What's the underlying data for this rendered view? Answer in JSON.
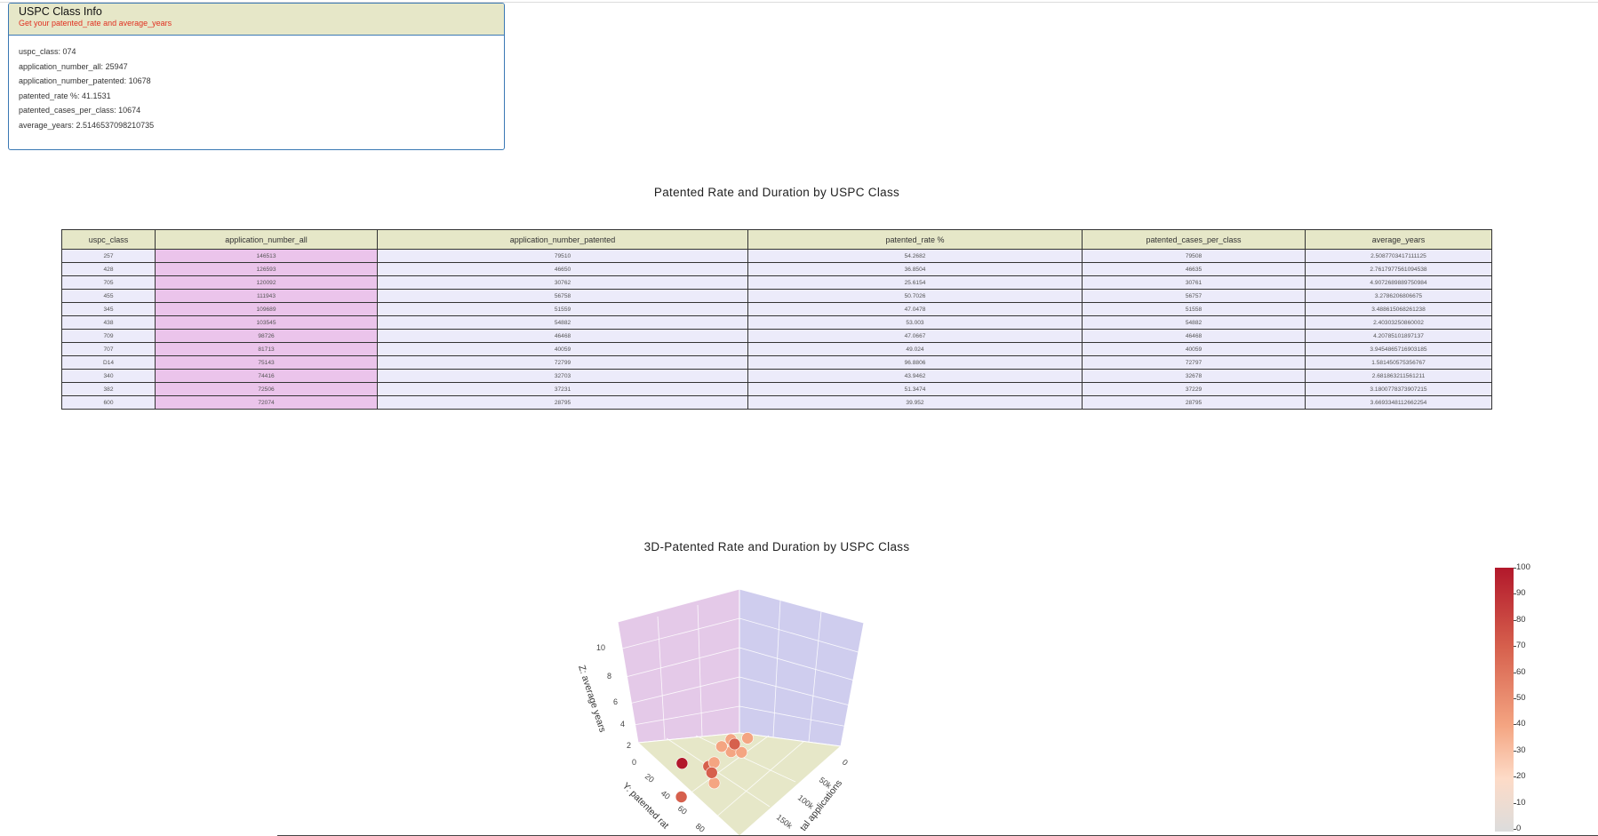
{
  "info_card": {
    "title": "USPC Class Info",
    "subtitle": "Get your patented_rate and average_years",
    "lines": [
      "uspc_class: 074",
      "application_number_all: 25947",
      "application_number_patented: 10678",
      "patented_rate %: 41.1531",
      "patented_cases_per_class: 10674",
      "average_years: 2.5146537098210735"
    ]
  },
  "table_section": {
    "title": "Patented Rate and Duration by USPC Class",
    "columns": [
      "uspc_class",
      "application_number_all",
      "application_number_patented",
      "patented_rate %",
      "patented_cases_per_class",
      "average_years"
    ],
    "rows": [
      [
        "257",
        "146513",
        "79510",
        "54.2682",
        "79508",
        "2.5087703417111125"
      ],
      [
        "428",
        "126593",
        "46650",
        "36.8504",
        "46635",
        "2.7617977561094538"
      ],
      [
        "705",
        "120092",
        "30762",
        "25.6154",
        "30761",
        "4.9072689889750984"
      ],
      [
        "455",
        "111943",
        "56758",
        "50.7026",
        "56757",
        "3.2786206806675"
      ],
      [
        "345",
        "109689",
        "51559",
        "47.0478",
        "51558",
        "3.488615068261238"
      ],
      [
        "438",
        "103545",
        "54882",
        "53.003",
        "54882",
        "2.40303250860002"
      ],
      [
        "709",
        "98726",
        "46468",
        "47.0667",
        "46468",
        "4.20785101897137"
      ],
      [
        "707",
        "81713",
        "40059",
        "49.024",
        "40059",
        "3.9454865716903185"
      ],
      [
        "D14",
        "75143",
        "72799",
        "96.8806",
        "72797",
        "1.581450575356767"
      ],
      [
        "340",
        "74416",
        "32703",
        "43.9462",
        "32678",
        "2.681863211561211"
      ],
      [
        "382",
        "72506",
        "37231",
        "51.3474",
        "37229",
        "3.1800778373907215"
      ],
      [
        "600",
        "72074",
        "28795",
        "39.952",
        "28795",
        "3.6693348112662254"
      ]
    ]
  },
  "plot_section": {
    "title": "3D-Patented Rate and Duration by USPC Class",
    "z_axis_title": "Z: average years",
    "y_axis_title": "Y: patented rat",
    "x_axis_title": "tal applications",
    "z_ticks": [
      "10",
      "8",
      "6",
      "4",
      "2",
      "0"
    ],
    "y_ticks": [
      "20",
      "40",
      "60",
      "80"
    ],
    "x_ticks": [
      "0",
      "50k",
      "100k",
      "150k"
    ]
  },
  "chart_data": {
    "type": "scatter",
    "title": "3D-Patented Rate and Duration by USPC Class",
    "xlabel": "tal applications",
    "ylabel": "Y: patented rat",
    "zlabel": "Z: average years",
    "x_ticks": [
      "0",
      "50k",
      "100k",
      "150k"
    ],
    "y_ticks": [
      "20",
      "40",
      "60",
      "80"
    ],
    "z_ticks": [
      "0",
      "2",
      "4",
      "6",
      "8",
      "10"
    ],
    "colorbar": {
      "range": [
        0,
        100
      ],
      "ticks": [
        "100",
        "90",
        "80",
        "70",
        "60",
        "50",
        "40",
        "30",
        "20",
        "10",
        "0"
      ],
      "colors": [
        "#dcdcdc",
        "#fddbc7",
        "#f4a582",
        "#d6604d",
        "#b2182b"
      ]
    },
    "points": [
      {
        "x": 146513,
        "y": 54.2682,
        "z": 2.51
      },
      {
        "x": 126593,
        "y": 36.8504,
        "z": 2.76
      },
      {
        "x": 120092,
        "y": 25.6154,
        "z": 4.91
      },
      {
        "x": 111943,
        "y": 50.7026,
        "z": 3.28
      },
      {
        "x": 109689,
        "y": 47.0478,
        "z": 3.49
      },
      {
        "x": 103545,
        "y": 53.003,
        "z": 2.4
      },
      {
        "x": 98726,
        "y": 47.0667,
        "z": 4.21
      },
      {
        "x": 81713,
        "y": 49.024,
        "z": 3.95
      },
      {
        "x": 75143,
        "y": 96.8806,
        "z": 1.58
      },
      {
        "x": 74416,
        "y": 43.9462,
        "z": 2.68
      },
      {
        "x": 72506,
        "y": 51.3474,
        "z": 3.18
      },
      {
        "x": 72074,
        "y": 39.952,
        "z": 3.67
      }
    ]
  }
}
